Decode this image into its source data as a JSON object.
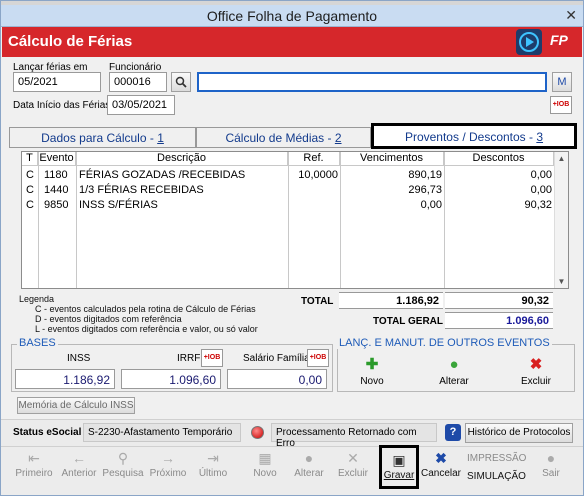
{
  "window": {
    "title": "Office Folha de Pagamento",
    "header": "Cálculo de Férias",
    "logo": "FP"
  },
  "form": {
    "launch_label": "Lançar férias em",
    "launch_value": "05/2021",
    "employee_label": "Funcionário",
    "employee_code": "000016",
    "employee_name": "",
    "m_button": "M",
    "start_label": "Data Início das Férias",
    "start_value": "03/05/2021"
  },
  "tabs": [
    {
      "label": "Dados para Cálculo - ",
      "num": "1"
    },
    {
      "label": "Cálculo de Médias - ",
      "num": "2"
    },
    {
      "label": "Proventos / Descontos - ",
      "num": "3"
    }
  ],
  "grid": {
    "headers": [
      "T",
      "Evento",
      "Descrição",
      "Ref.",
      "Vencimentos",
      "Descontos"
    ],
    "rows": [
      {
        "t": "C",
        "evento": "1180",
        "descricao": "FÉRIAS GOZADAS /RECEBIDAS",
        "ref": "10,0000",
        "venc": "890,19",
        "desc": "0,00"
      },
      {
        "t": "C",
        "evento": "1440",
        "descricao": "1/3 FÉRIAS  RECEBIDAS",
        "ref": "",
        "venc": "296,73",
        "desc": "0,00"
      },
      {
        "t": "C",
        "evento": "9850",
        "descricao": "INSS S/FÉRIAS",
        "ref": "",
        "venc": "0,00",
        "desc": "90,32"
      }
    ]
  },
  "legend": {
    "title": "Legenda",
    "lines": [
      "C - eventos calculados pela rotina de Cálculo de Férias",
      "D - eventos digitados com referência",
      "L - eventos digitados com referência e valor, ou só valor"
    ]
  },
  "totals": {
    "total_label": "TOTAL",
    "total_venc": "1.186,92",
    "total_desc": "90,32",
    "geral_label": "TOTAL GERAL",
    "geral_value": "1.096,60"
  },
  "bases": {
    "title": "BASES",
    "inss_label": "INSS",
    "inss_value": "1.186,92",
    "irrf_label": "IRRF",
    "irrf_value": "1.096,60",
    "salfam_label": "Salário Família",
    "salfam_value": "0,00"
  },
  "lanc": {
    "title": "LANÇ. E MANUT. DE OUTROS EVENTOS",
    "novo": "Novo",
    "alterar": "Alterar",
    "excluir": "Excluir"
  },
  "memoria_button": "Memória de Cálculo INSS",
  "esocial": {
    "label": "Status eSocial",
    "status": "S-2230-Afastamento Temporário",
    "process": "Processamento Retornado com Erro",
    "history_button": "Histórico de Protocolos"
  },
  "toolbar": {
    "primeiro": "Primeiro",
    "anterior": "Anterior",
    "pesquisa": "Pesquisa",
    "proximo": "Próximo",
    "ultimo": "Último",
    "novo": "Novo",
    "alterar": "Alterar",
    "excluir": "Excluir",
    "gravar": "Gravar",
    "cancelar": "Cancelar",
    "impressao": "IMPRESSÃO",
    "simulacao": "SIMULAÇÃO",
    "sair": "Sair"
  },
  "io_icon_text": "+IOB",
  "colors": {
    "header": "#d6272b",
    "tab_text": "#123a8c",
    "section": "#1e5bb8",
    "accent_blue": "#1e3c6a"
  }
}
